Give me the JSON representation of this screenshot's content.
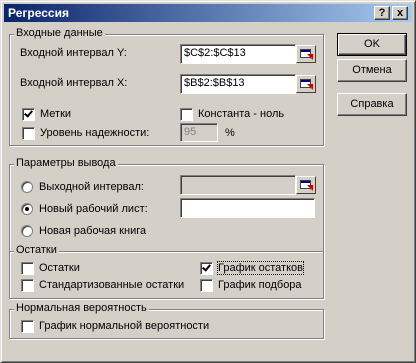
{
  "window": {
    "title": "Регрессия",
    "help_glyph": "?",
    "close_glyph": "x"
  },
  "input_group": {
    "legend": "Входные данные",
    "y_range_label": "Входной интервал Y:",
    "y_range_value": "$C$2:$C$13",
    "x_range_label": "Входной интервал X:",
    "x_range_value": "$B$2:$B$13",
    "labels_checkbox": "Метки",
    "labels_checked": true,
    "const_zero_checkbox": "Константа - ноль",
    "const_zero_checked": false,
    "confidence_checkbox": "Уровень надежности:",
    "confidence_checked": false,
    "confidence_value": "95",
    "percent_sign": "%"
  },
  "output_group": {
    "legend": "Параметры вывода",
    "output_range_label": "Выходной интервал:",
    "output_range_selected": false,
    "output_range_value": "",
    "new_sheet_label": "Новый рабочий лист:",
    "new_sheet_selected": true,
    "new_sheet_value": "",
    "new_workbook_label": "Новая рабочая книга",
    "new_workbook_selected": false
  },
  "residuals_group": {
    "legend": "Остатки",
    "residuals_label": "Остатки",
    "residuals_checked": false,
    "residual_plots_label": "График остатков",
    "residual_plots_checked": true,
    "standardized_label": "Стандартизованные остатки",
    "standardized_checked": false,
    "line_fit_label": "График подбора",
    "line_fit_checked": false
  },
  "normal_group": {
    "legend": "Нормальная вероятность",
    "normal_plot_label": "График нормальной вероятности",
    "normal_plot_checked": false
  },
  "buttons": {
    "ok": "OK",
    "cancel": "Отмена",
    "help": "Справка"
  }
}
